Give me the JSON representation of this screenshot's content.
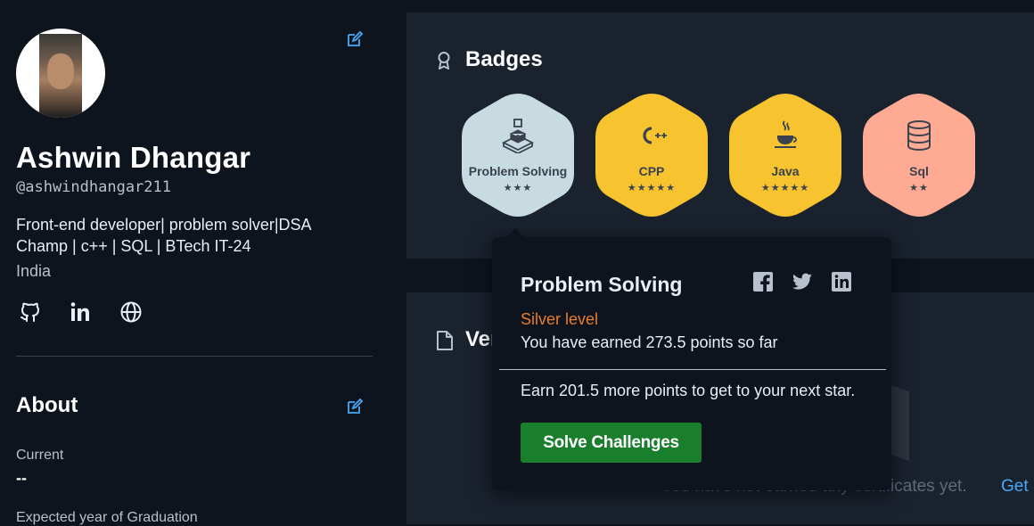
{
  "profile": {
    "name": "Ashwin Dhangar",
    "handle": "@ashwindhangar211",
    "bio": "Front-end developer| problem solver|DSA Champ | c++ | SQL | BTech IT-24",
    "country": "India"
  },
  "social": [
    "github-icon",
    "linkedin-icon",
    "globe-icon"
  ],
  "about": {
    "title": "About",
    "current_label": "Current",
    "current_value": "--",
    "year_of_graduation_label": "Expected year of Graduation"
  },
  "badges_section": {
    "title": "Badges",
    "badges": [
      {
        "label": "Problem Solving",
        "stars": "★★★",
        "stars_count": 3,
        "color": "#c7dbe1",
        "icon": "cube-stack-icon"
      },
      {
        "label": "CPP",
        "stars": "★★★★★",
        "stars_count": 5,
        "color": "#f7c32e",
        "icon": "cpp-icon"
      },
      {
        "label": "Java",
        "stars": "★★★★★",
        "stars_count": 5,
        "color": "#f7c32e",
        "icon": "java-cup-icon"
      },
      {
        "label": "Sql",
        "stars": "★★",
        "stars_count": 2,
        "color": "#ffab94",
        "icon": "database-icon"
      }
    ]
  },
  "verified_section": {
    "title": "Ver",
    "empty_text": "You have not earned any certificates yet.",
    "empty_link": "Get"
  },
  "popover": {
    "title": "Problem Solving",
    "level": "Silver level",
    "points_text": "You have earned 273.5 points so far",
    "next_text": "Earn 201.5 more points to get to your next star.",
    "button_label": "Solve Challenges",
    "share": [
      "facebook-icon",
      "twitter-icon",
      "linkedin-icon"
    ]
  },
  "colors": {
    "background": "#0e141e",
    "card": "#1a222e",
    "accent_link": "#48a9f8",
    "level": "#e87d2d",
    "button": "#1a7f2d"
  }
}
